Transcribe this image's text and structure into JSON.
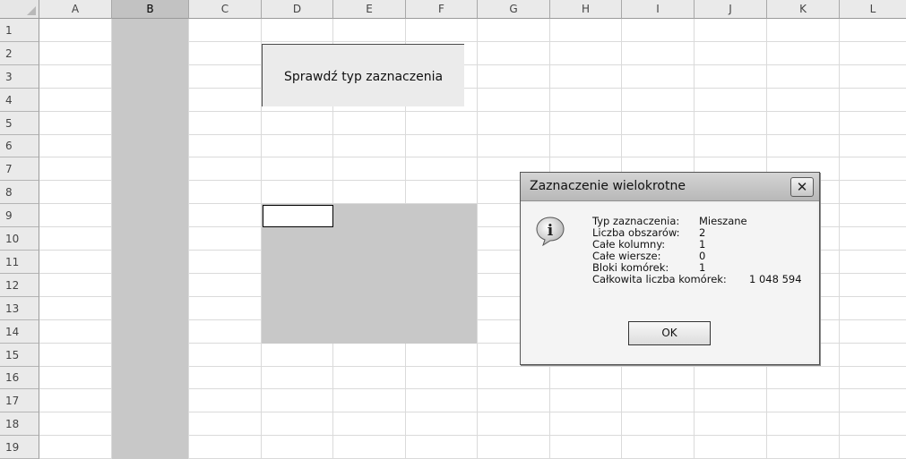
{
  "columns": [
    "A",
    "B",
    "C",
    "D",
    "E",
    "F",
    "G",
    "H",
    "I",
    "J",
    "K",
    "L"
  ],
  "rows": [
    "1",
    "2",
    "3",
    "4",
    "5",
    "6",
    "7",
    "8",
    "9",
    "10",
    "11",
    "12",
    "13",
    "14",
    "15",
    "16",
    "17",
    "18",
    "19"
  ],
  "macro_button": {
    "label": "Sprawdź typ zaznaczenia"
  },
  "dialog": {
    "title": "Zaznaczenie wielokrotne",
    "close_label": "✕",
    "icon": "info-icon",
    "rows": [
      {
        "label": "Typ zaznaczenia:",
        "value": "Mieszane"
      },
      {
        "label": "Liczba obszarów:",
        "value": "2"
      },
      {
        "label": "Całe kolumny:",
        "value": "1"
      },
      {
        "label": "Całe wiersze:",
        "value": "0"
      },
      {
        "label": "Bloki komórek:",
        "value": "1"
      },
      {
        "label": "Całkowita liczba komórek:",
        "value": "1 048 594"
      }
    ],
    "ok_label": "OK"
  },
  "colors": {
    "selection_fill": "#c8c8c8",
    "header_selected": "#c2c2c2"
  }
}
